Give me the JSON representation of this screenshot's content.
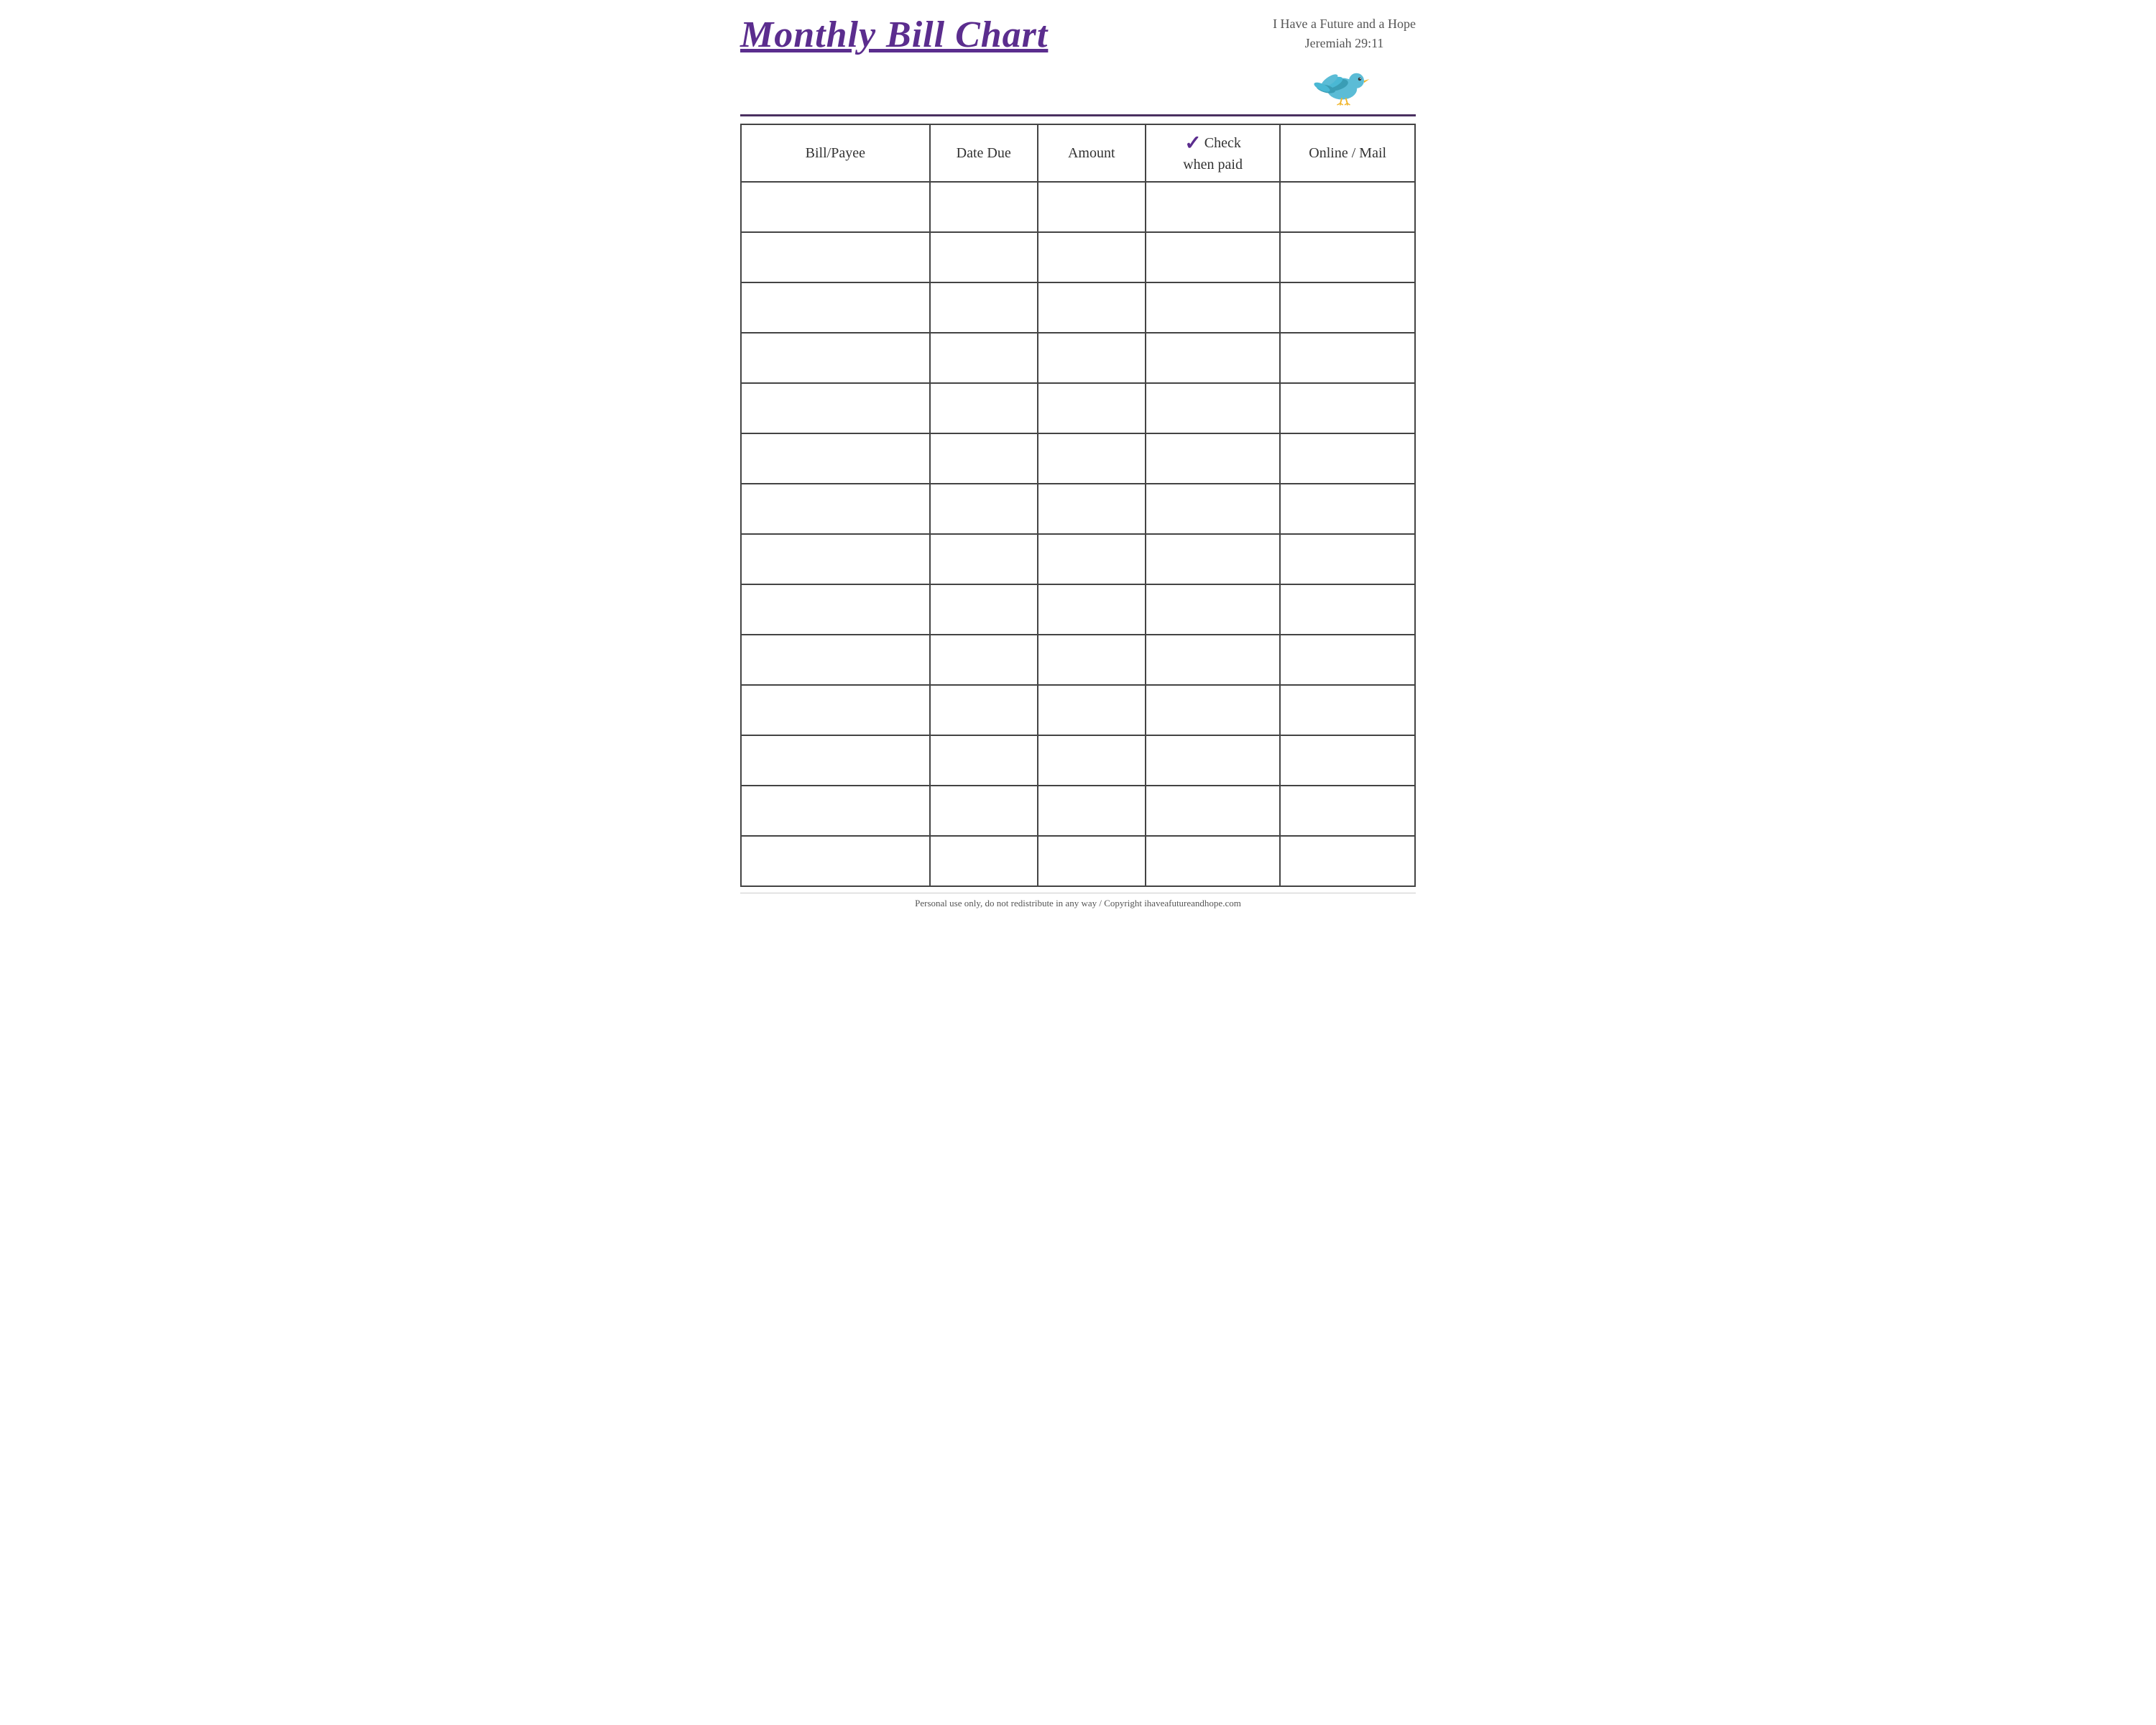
{
  "header": {
    "title": "Monthly Bill Chart",
    "scripture_line1": "I Have a Future and a Hope",
    "scripture_line2": "Jeremiah 29:11"
  },
  "table": {
    "columns": [
      {
        "key": "bill_payee",
        "label": "Bill/Payee"
      },
      {
        "key": "date_due",
        "label": "Date Due"
      },
      {
        "key": "amount",
        "label": "Amount"
      },
      {
        "key": "check_when_paid",
        "label": "Check when paid",
        "has_checkmark": true
      },
      {
        "key": "online_mail",
        "label": "Online / Mail"
      }
    ],
    "row_count": 14
  },
  "footer": {
    "text": "Personal use only, do not redistribute in any way / Copyright ihaveafutureandhope.com"
  }
}
